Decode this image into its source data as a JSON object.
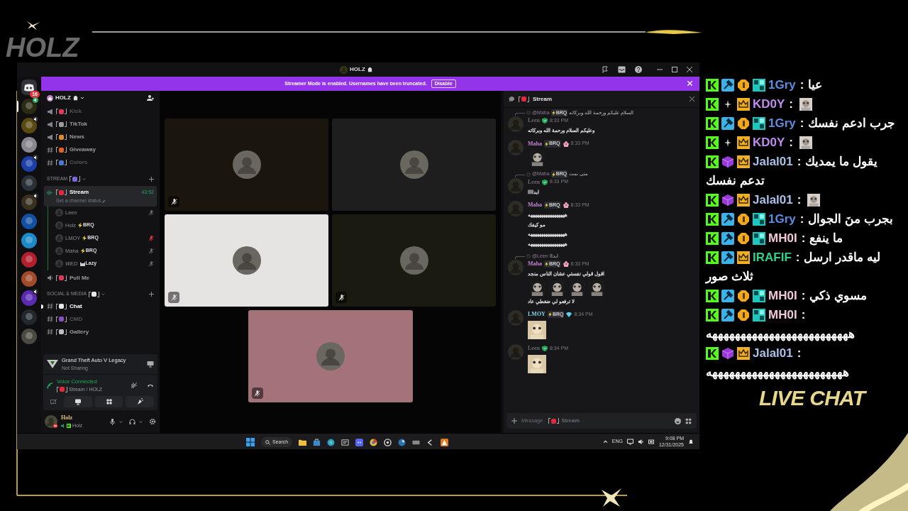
{
  "overlay": {
    "logo": "HOLZ",
    "live_chat_label": "LIVE CHAT"
  },
  "window": {
    "title": "HOLZ"
  },
  "banner": {
    "text": "Streamer Mode is enabled. Usernames have been truncated.",
    "button": "Disable"
  },
  "servers": [
    {
      "kind": "home",
      "badge": "16"
    },
    {
      "kind": "server",
      "color": "#2b2a14",
      "speaking": true,
      "selected": true
    },
    {
      "kind": "server",
      "color": "#5a4a10",
      "speaking": true,
      "selected": false
    },
    {
      "kind": "server",
      "color": "#8a8790",
      "speaking": false,
      "selected": false
    },
    {
      "kind": "server",
      "color": "#1c3fa8",
      "speaking": true,
      "selected": false
    },
    {
      "kind": "server",
      "color": "#2a3238",
      "speaking": false,
      "selected": false
    },
    {
      "kind": "server",
      "color": "#3a3020",
      "speaking": true,
      "selected": false
    },
    {
      "kind": "server",
      "color": "#1450a0",
      "speaking": false,
      "selected": false
    },
    {
      "kind": "server",
      "color": "#1a8ac8",
      "speaking": false,
      "selected": false
    },
    {
      "kind": "server",
      "color": "#b0202c",
      "speaking": false,
      "selected": false
    },
    {
      "kind": "server",
      "color": "#a04a2a",
      "speaking": false,
      "selected": false
    },
    {
      "kind": "server",
      "color": "#5a2ab0",
      "speaking": true,
      "selected": false
    },
    {
      "kind": "server",
      "color": "#22282c",
      "speaking": false,
      "selected": false
    },
    {
      "kind": "server",
      "color": "#4a4a40",
      "speaking": false,
      "selected": false
    }
  ],
  "sidebar": {
    "server_name": "HOLZ",
    "items": [
      {
        "kind": "announcement",
        "name": "Kick",
        "color": "#e03a5a",
        "muted": true,
        "unread": false
      },
      {
        "kind": "announcement",
        "name": "TikTok",
        "color": "#9a9aa0",
        "muted": false,
        "unread": false
      },
      {
        "kind": "announcement",
        "name": "News",
        "color": "#e08a2a",
        "muted": false,
        "unread": false
      },
      {
        "kind": "text",
        "name": "Giveaway",
        "color": "#e0602a",
        "muted": false,
        "unread": false
      },
      {
        "kind": "text",
        "name": "Colors",
        "color": "#4a7ad0",
        "muted": true,
        "unread": false
      },
      {
        "kind": "category",
        "name": "STREAM",
        "color": "#7a6ae0"
      },
      {
        "kind": "voice",
        "name": "Stream",
        "color": "#e8283c",
        "selected": true,
        "timer": "43:52",
        "status": "Set a channel status",
        "children": [
          {
            "name": "Leen",
            "muted": true,
            "deafened": false
          },
          {
            "name": "Holz",
            "tag": {
              "kind": "bolt",
              "text": "BRQ"
            },
            "muted": false,
            "deafened": false
          },
          {
            "name": "LMOY",
            "tag": {
              "kind": "bolt",
              "text": "BRQ"
            },
            "muted": false,
            "deafened": true
          },
          {
            "name": "Maha",
            "tag": {
              "kind": "bolt",
              "text": "BRQ"
            },
            "muted": true,
            "deafened": false
          },
          {
            "name": "WED",
            "tag": {
              "kind": "cat",
              "text": "Lazy"
            },
            "muted": true,
            "deafened": false
          }
        ]
      },
      {
        "kind": "voice",
        "name": "Pull Me",
        "color": "#e03a5a",
        "selected": false
      },
      {
        "kind": "category",
        "name": "SOCIAL & MEDIA",
        "color": "#e8e8e8"
      },
      {
        "kind": "text",
        "name": "Chat",
        "color": "#e8e8e8",
        "muted": false,
        "unread": true
      },
      {
        "kind": "text",
        "name": "CMD",
        "color": "#8a50c0",
        "muted": true,
        "unread": false
      },
      {
        "kind": "text",
        "name": "Gallery",
        "color": "#c0c0c0",
        "muted": false,
        "unread": false
      }
    ]
  },
  "activity": {
    "game": "Grand Theft Auto V Legacy",
    "status": "Not Sharing"
  },
  "voice": {
    "title": "Voice Connected",
    "location": "Stream / HOLZ"
  },
  "user": {
    "name": "Holz",
    "status": "Holz"
  },
  "tiles": [
    {
      "color": "#1a160e",
      "muted": true
    },
    {
      "color": "#1e1e1e",
      "muted": false
    },
    {
      "color": "#e6e3e3",
      "muted": true
    },
    {
      "color": "#1a1a10",
      "muted": true
    },
    {
      "color": "#a4737a",
      "muted": true
    }
  ],
  "chat": {
    "channel": "Stream",
    "messages": [
      {
        "reply": {
          "user": "@Maha",
          "tag": "BRQ",
          "text": "السلام عليكم ورحمة الله وبركاته"
        },
        "author": "Leen",
        "color": "#6a6a6a",
        "badge": {
          "kind": "shield"
        },
        "time": "8:33 PM",
        "blocks": [
          {
            "kind": "text",
            "text": "وعليكم السلام ورحمة الله وبركاته"
          }
        ]
      },
      {
        "author": "Maha",
        "color": "#c084d0",
        "tag": "BRQ",
        "badge": {
          "kind": "flower"
        },
        "time": "8:33 PM",
        "blocks": [
          {
            "kind": "stickers",
            "items": [
              {
                "kind": "sticker"
              }
            ]
          }
        ]
      },
      {
        "reply": {
          "user": "@Maha",
          "tag": "BRQ",
          "text": "متى نمت"
        },
        "author": "Leen",
        "color": "#6a6a6a",
        "badge": {
          "kind": "shield"
        },
        "time": "8:33 PM",
        "blocks": [
          {
            "kind": "text",
            "text": "ابداااا"
          }
        ]
      },
      {
        "author": "Maha",
        "color": "#c084d0",
        "tag": "BRQ",
        "badge": {
          "kind": "flower"
        },
        "time": "8:33 PM",
        "blocks": [
          {
            "kind": "text",
            "text": "هههههههههههههههههه"
          },
          {
            "kind": "text",
            "text": "مو كيفك"
          },
          {
            "kind": "text",
            "text": "هههههههههههههههههه"
          },
          {
            "kind": "text",
            "text": "هههههههههههههههههه"
          }
        ]
      },
      {
        "reply": {
          "user": "@Leen",
          "text": "ابداا"
        },
        "author": "Maha",
        "color": "#c084d0",
        "tag": "BRQ",
        "badge": {
          "kind": "flower"
        },
        "time": "8:33 PM",
        "blocks": [
          {
            "kind": "text",
            "text": "اقول قولي نفستي عشان الناس منجد"
          },
          {
            "kind": "stickers",
            "items": [
              {
                "kind": "sticker"
              },
              {
                "kind": "sticker"
              },
              {
                "kind": "sticker"
              },
              {
                "kind": "sticker"
              }
            ]
          },
          {
            "kind": "text",
            "text": "لا ترفعو لي ضغطي عاد"
          }
        ]
      },
      {
        "author": "LMOY",
        "color": "#7fd0e0",
        "tag": "BRQ",
        "badge": {
          "kind": "diamond"
        },
        "time": "8:34 PM"
      },
      {
        "author": "Leen",
        "color": "#6a6a6a",
        "badge": {
          "kind": "shield"
        },
        "time": "8:34 PM"
      }
    ],
    "composer": {
      "placeholder": "Message",
      "channel": "Stream"
    }
  },
  "taskbar": {
    "search": "Search",
    "language": "ENG",
    "time": "9:08 PM",
    "date": "12/31/2025"
  },
  "live_chat": [
    {
      "badges": [
        {
          "kind": "kick"
        },
        {
          "kind": "hammer"
        },
        {
          "kind": "coin"
        },
        {
          "kind": "tile"
        }
      ],
      "user": "1Gry",
      "color": "#5b8ee0",
      "kind": "text",
      "text": "عيا"
    },
    {
      "badges": [
        {
          "kind": "kick"
        },
        {
          "kind": "spark"
        },
        {
          "kind": "crown"
        }
      ],
      "user": "KD0Y",
      "color": "#c08af0"
    },
    {
      "badges": [
        {
          "kind": "kick"
        },
        {
          "kind": "hammer"
        },
        {
          "kind": "coin"
        },
        {
          "kind": "tile"
        }
      ],
      "user": "1Gry",
      "color": "#5b8ee0",
      "kind": "text",
      "text": "جرب ادعم نفسك"
    },
    {
      "badges": [
        {
          "kind": "kick"
        },
        {
          "kind": "spark"
        },
        {
          "kind": "crown"
        }
      ],
      "user": "KD0Y",
      "color": "#c08af0"
    },
    {
      "badges": [
        {
          "kind": "kick"
        },
        {
          "kind": "cube"
        },
        {
          "kind": "crown"
        }
      ],
      "user": "Jalal01",
      "color": "#a8c0e8",
      "kind": "text",
      "text": "يقول ما يمديك",
      "continuation": "تدعم نفسك"
    },
    {
      "badges": [
        {
          "kind": "kick"
        },
        {
          "kind": "cube"
        },
        {
          "kind": "crown"
        }
      ],
      "user": "Jalal01",
      "color": "#a8c0e8"
    },
    {
      "badges": [
        {
          "kind": "kick"
        },
        {
          "kind": "hammer"
        },
        {
          "kind": "coin"
        },
        {
          "kind": "tile"
        }
      ],
      "user": "1Gry",
      "color": "#5b8ee0",
      "kind": "text",
      "text": "بجرب منَ الجوال"
    },
    {
      "badges": [
        {
          "kind": "kick"
        },
        {
          "kind": "hammer"
        },
        {
          "kind": "coin"
        },
        {
          "kind": "tile"
        }
      ],
      "user": "MH0I",
      "color": "#f0c8d8",
      "kind": "text",
      "text": "ما ينفع"
    },
    {
      "badges": [
        {
          "kind": "kick"
        },
        {
          "kind": "hammer"
        },
        {
          "kind": "crown"
        }
      ],
      "user": "IRAFIF",
      "color": "#2fd08a",
      "kind": "text",
      "text": "ليه ماقدر ارسل",
      "continuation": "ثلاث صور"
    },
    {
      "badges": [
        {
          "kind": "kick"
        },
        {
          "kind": "hammer"
        },
        {
          "kind": "coin"
        },
        {
          "kind": "tile"
        }
      ],
      "user": "MH0I",
      "color": "#f0c8d8",
      "kind": "text",
      "text": "مسوي ذكي"
    },
    {
      "badges": [
        {
          "kind": "kick"
        },
        {
          "kind": "hammer"
        },
        {
          "kind": "coin"
        },
        {
          "kind": "tile"
        }
      ],
      "user": "MH0I",
      "color": "#f0c8d8",
      "kind": "text",
      "continuation": "هههههههههههههههههههههههههه"
    },
    {
      "badges": [
        {
          "kind": "kick"
        },
        {
          "kind": "cube"
        },
        {
          "kind": "crown"
        }
      ],
      "user": "Jalal01",
      "color": "#a8c0e8",
      "kind": "text",
      "continuation": "ههههههههههههههههههههههههه"
    }
  ],
  "separator": ":"
}
